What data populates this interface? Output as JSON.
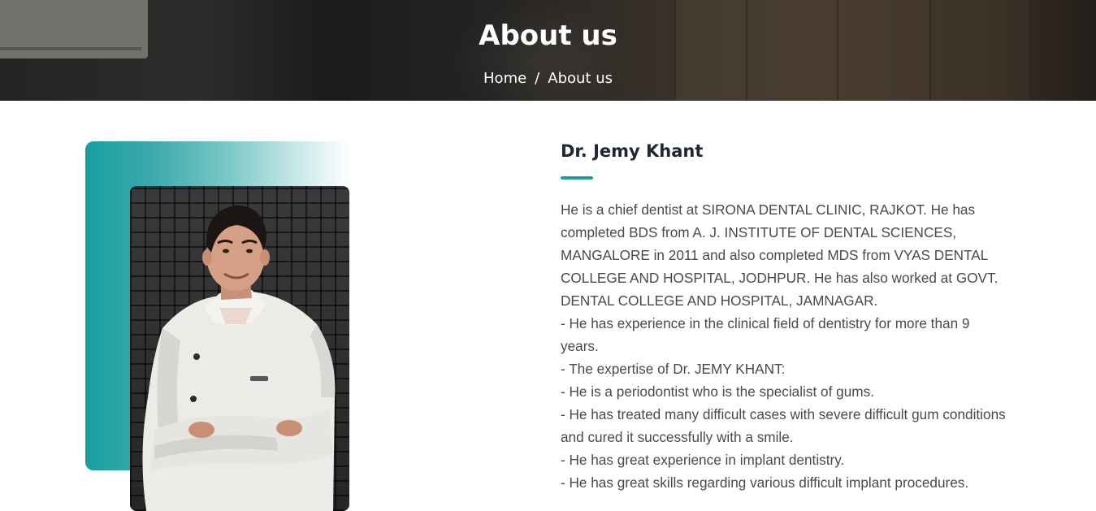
{
  "hero": {
    "title": "About us",
    "breadcrumb": {
      "home": "Home",
      "separator": "/",
      "current": "About us"
    }
  },
  "doctor": {
    "name": "Dr. Jemy Khant",
    "accent_color": "#1a9ea1",
    "bio_lines": [
      "He is a chief dentist at SIRONA DENTAL CLINIC, RAJKOT. He has completed BDS from A. J. INSTITUTE OF DENTAL SCIENCES, MANGALORE in 2011 and also completed MDS from VYAS DENTAL COLLEGE AND HOSPITAL, JODHPUR. He has also worked at GOVT. DENTAL COLLEGE AND HOSPITAL, JAMNAGAR.",
      "- He has experience in the clinical field of dentistry for more than 9 years.",
      "- The expertise of Dr. JEMY KHANT:",
      "- He is a periodontist who is the specialist of gums.",
      "- He has treated many difficult cases with severe difficult gum conditions and cured it successfully with a smile.",
      "- He has great experience in implant dentistry.",
      "- He has great skills regarding various difficult implant procedures."
    ]
  }
}
